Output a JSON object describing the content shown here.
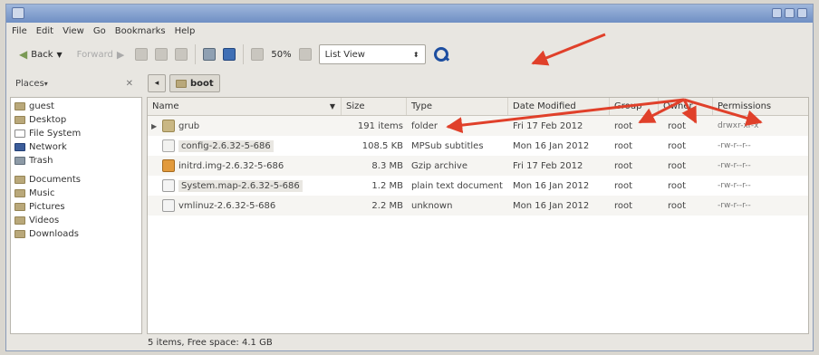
{
  "menus": [
    "File",
    "Edit",
    "View",
    "Go",
    "Bookmarks",
    "Help"
  ],
  "toolbar": {
    "back": "Back",
    "forward": "Forward",
    "zoom": "50%",
    "view_mode": "List View"
  },
  "sidebar": {
    "header": "Places",
    "items": [
      "guest",
      "Desktop",
      "File System",
      "Network",
      "Trash",
      "Documents",
      "Music",
      "Pictures",
      "Videos",
      "Downloads"
    ]
  },
  "path": {
    "current": "boot"
  },
  "columns": [
    "Name",
    "Size",
    "Type",
    "Date Modified",
    "Group",
    "Owner",
    "Permissions"
  ],
  "files": [
    {
      "name": "grub",
      "size": "191 items",
      "type": "folder",
      "date": "Fri 17 Feb 2012",
      "group": "root",
      "owner": "root",
      "perm": "drwxr-xr-x"
    },
    {
      "name": "config-2.6.32-5-686",
      "size": "108.5 KB",
      "type": "MPSub subtitles",
      "date": "Mon 16 Jan 2012",
      "group": "root",
      "owner": "root",
      "perm": "-rw-r--r--"
    },
    {
      "name": "initrd.img-2.6.32-5-686",
      "size": "8.3 MB",
      "type": "Gzip archive",
      "date": "Fri 17 Feb 2012",
      "group": "root",
      "owner": "root",
      "perm": "-rw-r--r--"
    },
    {
      "name": "System.map-2.6.32-5-686",
      "size": "1.2 MB",
      "type": "plain text document",
      "date": "Mon 16 Jan 2012",
      "group": "root",
      "owner": "root",
      "perm": "-rw-r--r--"
    },
    {
      "name": "vmlinuz-2.6.32-5-686",
      "size": "2.2 MB",
      "type": "unknown",
      "date": "Mon 16 Jan 2012",
      "group": "root",
      "owner": "root",
      "perm": "-rw-r--r--"
    }
  ],
  "status": "5 items, Free space: 4.1 GB",
  "colors": {
    "annotation_arrow": "#e0402a",
    "titlebar": "#7f9fd0",
    "search_icon": "#1d4ea0"
  }
}
